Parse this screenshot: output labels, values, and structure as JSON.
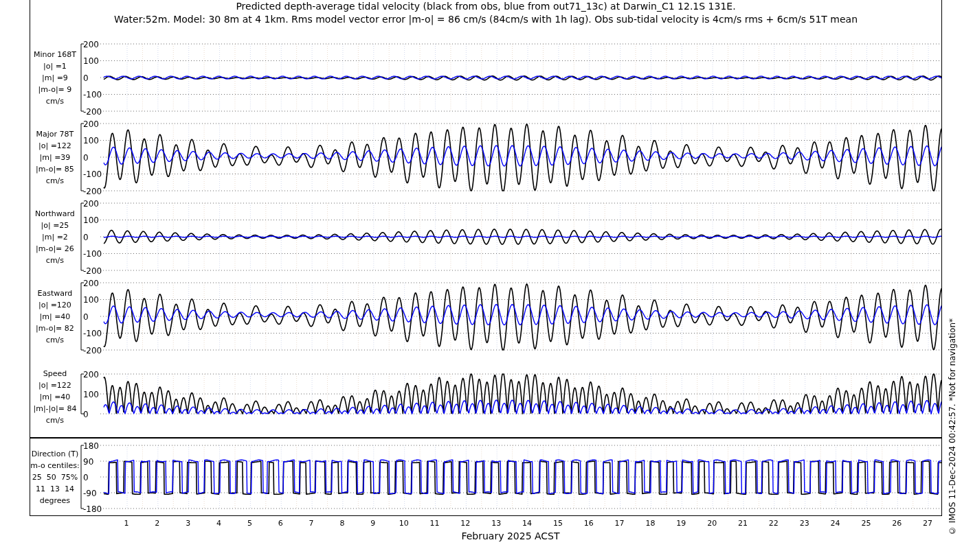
{
  "title": "Predicted depth-average tidal velocity (black from obs, blue from out71_13c) at Darwin_C1 12.1S 131E.",
  "subtitle": "Water:52m. Model: 30 8m at 4 1km. Rms model vector error |m-o| = 86 cm/s (84cm/s with 1h lag). Obs sub-tidal velocity is 4cm/s rms + 6cm/s 51T mean",
  "panels": [
    {
      "kind": "minor",
      "label": [
        "Minor 168T",
        "|o| =1",
        "|m| =9",
        "|m-o|= 9",
        "cm/s"
      ],
      "yticks": [
        "200",
        "100",
        "0",
        "-100",
        "-200"
      ]
    },
    {
      "kind": "major",
      "label": [
        "Major 78T",
        "|o| =122",
        "|m| =39",
        "|m-o|= 85",
        "cm/s"
      ],
      "yticks": [
        "200",
        "100",
        "0",
        "-100",
        "-200"
      ]
    },
    {
      "kind": "northward",
      "label": [
        "Northward",
        "|o| =25",
        "|m| =2",
        "|m-o|= 26",
        "cm/s"
      ],
      "yticks": [
        "200",
        "100",
        "0",
        "-100",
        "-200"
      ]
    },
    {
      "kind": "eastward",
      "label": [
        "Eastward",
        "|o| =120",
        "|m| =40",
        "|m-o|= 82",
        "cm/s"
      ],
      "yticks": [
        "200",
        "100",
        "0",
        "-100",
        "-200"
      ]
    },
    {
      "kind": "speed",
      "label": [
        "Speed",
        "|o| =122",
        "|m| =40",
        "|m|-|o|= 84",
        "cm/s"
      ],
      "yticks": [
        "200",
        "100",
        "0"
      ]
    },
    {
      "kind": "direction",
      "label": [
        "Direction (T)",
        "m-o centiles:",
        "25  50  75%",
        "11  13  14",
        "degrees"
      ],
      "yticks": [
        "180",
        "90",
        "0",
        "-90",
        "-180"
      ]
    }
  ],
  "days": [
    "1",
    "2",
    "3",
    "4",
    "5",
    "6",
    "7",
    "8",
    "9",
    "10",
    "11",
    "12",
    "13",
    "14",
    "15",
    "16",
    "17",
    "18",
    "19",
    "20",
    "21",
    "22",
    "23",
    "24",
    "25",
    "26",
    "27"
  ],
  "xlabel": "February 2025 ACST",
  "credit": "© IMOS 11-Dec-2024 00:42:57. *Not for navigation*"
}
